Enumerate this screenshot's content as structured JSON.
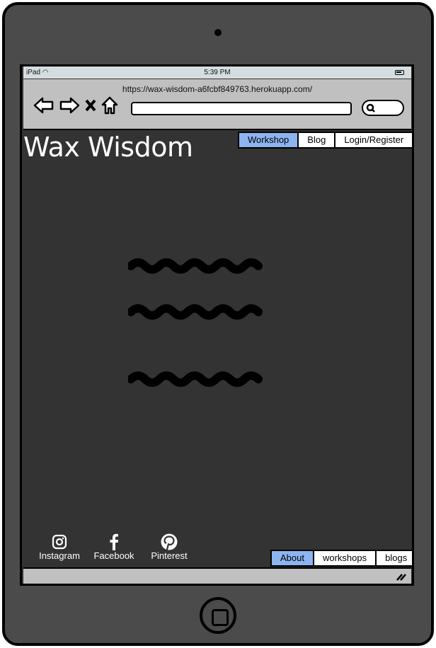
{
  "status_bar": {
    "device": "iPad",
    "time": "5:39 PM"
  },
  "browser": {
    "url": "https://wax-wisdom-a6fcbf849763.herokuapp.com/",
    "address_value": "",
    "search_value": ""
  },
  "header": {
    "logo": "Wax Wisdom",
    "nav": [
      {
        "label": "Workshop",
        "active": true
      },
      {
        "label": "Blog"
      },
      {
        "label": "Login/Register"
      }
    ]
  },
  "footer": {
    "social": [
      {
        "label": "Instagram",
        "icon": "instagram-icon"
      },
      {
        "label": "Facebook",
        "icon": "facebook-icon"
      },
      {
        "label": "Pinterest",
        "icon": "pinterest-icon"
      }
    ],
    "nav": [
      {
        "label": "About",
        "active": true
      },
      {
        "label": "workshops"
      },
      {
        "label": "blogs"
      }
    ]
  },
  "colors": {
    "accent": "#8cb4f0",
    "content_bg": "#333333",
    "chrome": "#c0c0c0"
  }
}
